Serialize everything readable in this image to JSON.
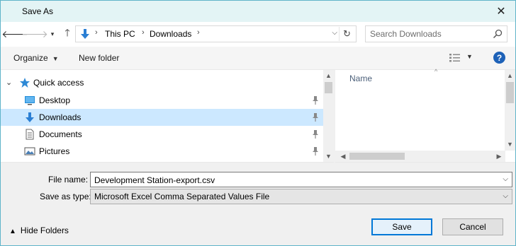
{
  "window": {
    "title": "Save As"
  },
  "nav": {
    "breadcrumb": [
      "This PC",
      "Downloads"
    ],
    "search_placeholder": "Search Downloads"
  },
  "toolbar": {
    "organize_label": "Organize",
    "new_folder_label": "New folder"
  },
  "tree": {
    "quick_access": "Quick access",
    "items": [
      {
        "label": "Desktop",
        "icon": "desktop-icon",
        "pinned": true,
        "selected": false
      },
      {
        "label": "Downloads",
        "icon": "downloads-icon",
        "pinned": true,
        "selected": true
      },
      {
        "label": "Documents",
        "icon": "documents-icon",
        "pinned": true,
        "selected": false
      },
      {
        "label": "Pictures",
        "icon": "pictures-icon",
        "pinned": true,
        "selected": false
      }
    ]
  },
  "file_list": {
    "column_name": "Name"
  },
  "form": {
    "file_name_label": "File name:",
    "file_name_value": "Development Station-export.csv",
    "save_type_label": "Save as type:",
    "save_type_value": "Microsoft Excel Comma Separated Values File"
  },
  "footer": {
    "hide_folders_label": "Hide Folders",
    "save_label": "Save",
    "cancel_label": "Cancel"
  },
  "colors": {
    "accent": "#0078d7",
    "selected_row": "#cce8ff",
    "titlebar": "#e3f4f5"
  }
}
